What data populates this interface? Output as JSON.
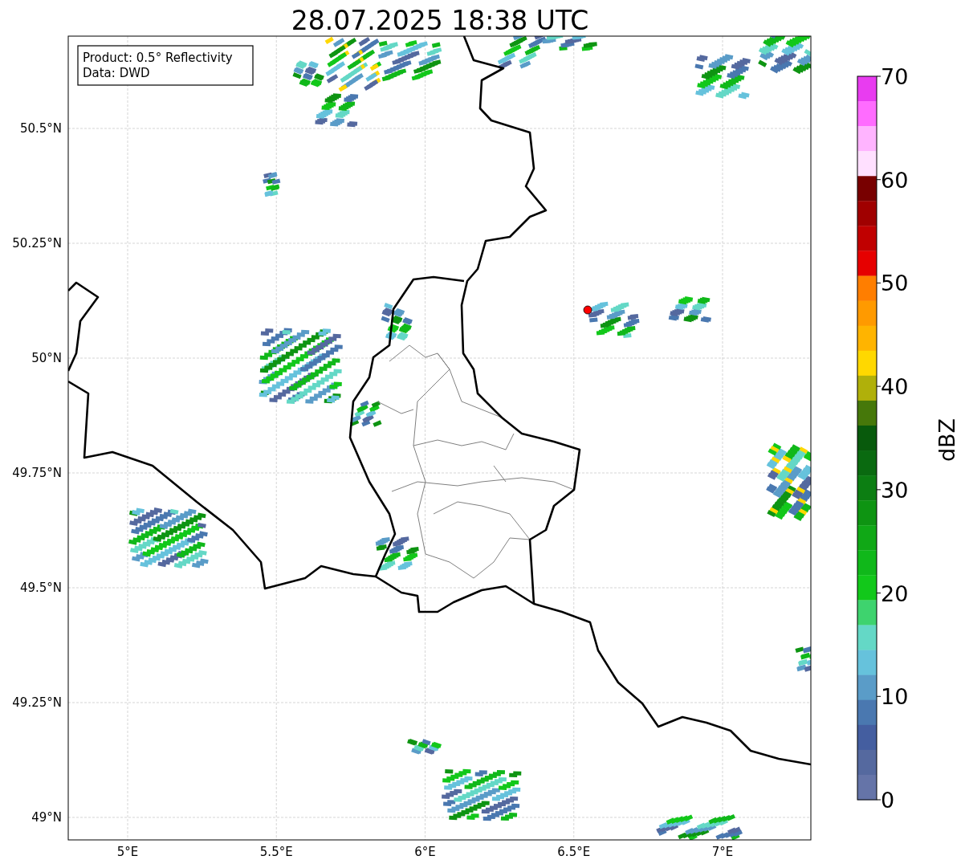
{
  "title": "28.07.2025 18:38 UTC",
  "info_box": {
    "lines": [
      "Product: 0.5° Reflectivity",
      "Data: DWD"
    ]
  },
  "map": {
    "x_labels": [
      "5°E",
      "5.5°E",
      "6°E",
      "6.5°E",
      "7°E"
    ],
    "y_labels": [
      "50.5°N",
      "50.25°N",
      "50°N",
      "49.75°N",
      "49.5°N",
      "49.25°N",
      "49°N"
    ]
  },
  "colorbar": {
    "label": "dBZ",
    "tick_labels": [
      "70",
      "60",
      "50",
      "40",
      "30",
      "20",
      "10",
      "0"
    ],
    "bands": [
      {
        "color": "#e83cf0"
      },
      {
        "color": "#ff6cff"
      },
      {
        "color": "#ffb4ff"
      },
      {
        "color": "#ffe0ff"
      },
      {
        "color": "#780000"
      },
      {
        "color": "#a00000"
      },
      {
        "color": "#c00000"
      },
      {
        "color": "#e60000"
      },
      {
        "color": "#ff7e00"
      },
      {
        "color": "#ff9a00"
      },
      {
        "color": "#ffb400"
      },
      {
        "color": "#ffd800"
      },
      {
        "color": "#b0b00a"
      },
      {
        "color": "#46780a"
      },
      {
        "color": "#085a0c"
      },
      {
        "color": "#0a6a10"
      },
      {
        "color": "#0c7e12"
      },
      {
        "color": "#0e9412"
      },
      {
        "color": "#10a816"
      },
      {
        "color": "#10b81a"
      },
      {
        "color": "#12c81a"
      },
      {
        "color": "#3ed36e"
      },
      {
        "color": "#64d8c6"
      },
      {
        "color": "#66c2dc"
      },
      {
        "color": "#5a9cc8"
      },
      {
        "color": "#4a78b0"
      },
      {
        "color": "#445ea0"
      },
      {
        "color": "#55699f"
      },
      {
        "color": "#6574a8"
      }
    ]
  }
}
